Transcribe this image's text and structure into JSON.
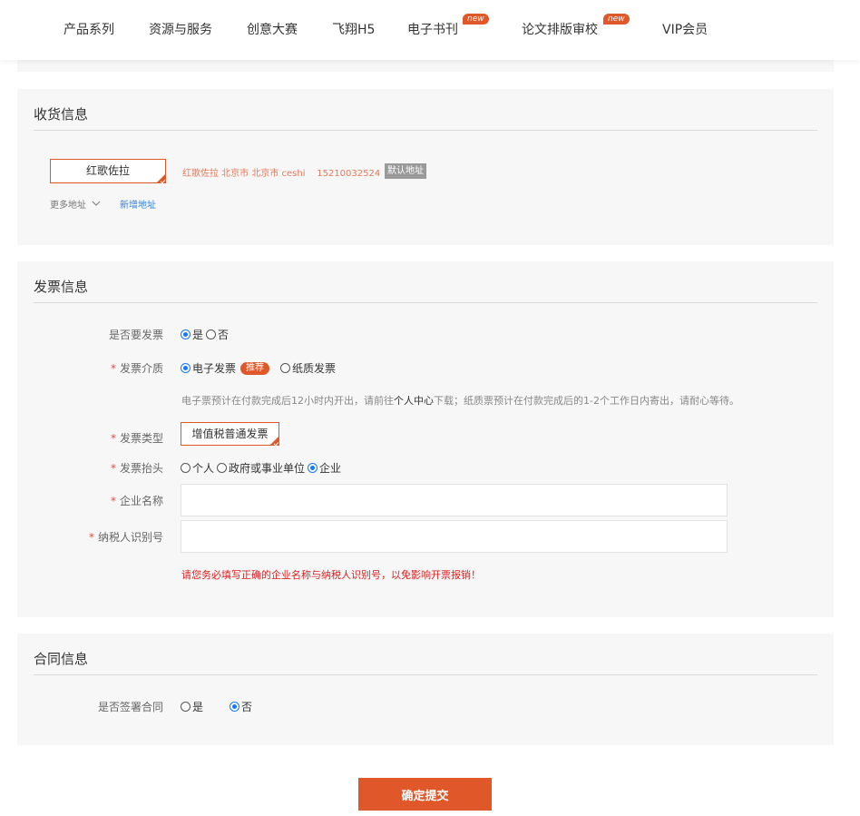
{
  "nav": {
    "items": [
      {
        "label": "产品系列"
      },
      {
        "label": "资源与服务"
      },
      {
        "label": "创意大赛"
      },
      {
        "label": "飞翔H5"
      },
      {
        "label": "电子书刊",
        "badge": "new"
      },
      {
        "label": "论文排版审校",
        "badge": "new"
      },
      {
        "label": "VIP会员"
      }
    ]
  },
  "shipping": {
    "title": "收货信息",
    "selected_name": "红歌佐拉",
    "address_detail": "红歌佐拉 北京市 北京市 ceshi    15210032524",
    "default_tag": "默认地址",
    "more_label": "更多地址",
    "add_label": "新增地址"
  },
  "invoice": {
    "title": "发票信息",
    "need_label": "是否要发票",
    "need_options": [
      "是",
      "否"
    ],
    "need_selected": "是",
    "medium_label": "发票介质",
    "medium_options": [
      "电子发票",
      "纸质发票"
    ],
    "medium_selected": "电子发票",
    "recommend_tag": "推荐",
    "hint_before": "电子票预计在付款完成后12小时内开出，请前往",
    "hint_link": "个人中心",
    "hint_after": "下载；纸质票预计在付款完成后的1-2个工作日内寄出，请耐心等待。",
    "type_label": "发票类型",
    "type_value": "增值税普通发票",
    "header_label": "发票抬头",
    "header_options": [
      "个人",
      "政府或事业单位",
      "企业"
    ],
    "header_selected": "企业",
    "company_label": "企业名称",
    "company_value": "",
    "tax_label": "纳税人识别号",
    "tax_value": "",
    "warning": "请您务必填写正确的企业名称与纳税人识别号，以免影响开票报销！"
  },
  "contract": {
    "title": "合同信息",
    "sign_label": "是否签署合同",
    "options": [
      "是",
      "否"
    ],
    "selected": "否"
  },
  "submit_label": "确定提交",
  "colors": {
    "accent": "#e0572a",
    "radio_selected": "#1677ff",
    "warning": "#e02020",
    "link": "#3a7fd4"
  }
}
